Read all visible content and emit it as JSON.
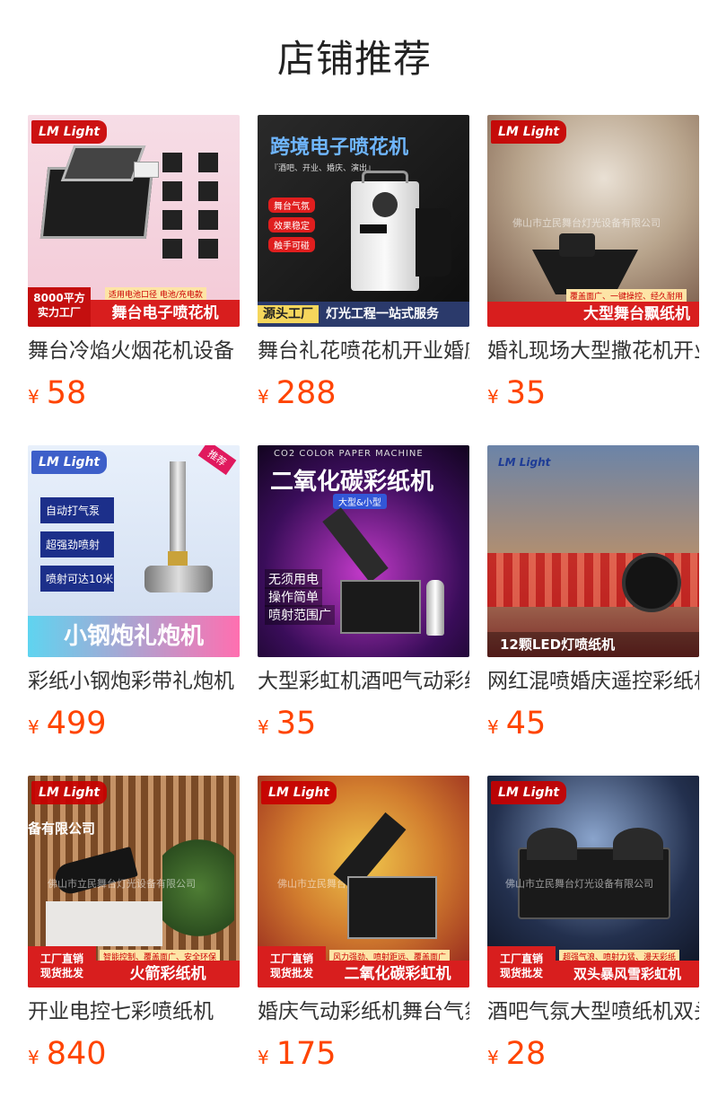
{
  "page": {
    "title": "店铺推荐"
  },
  "products": [
    {
      "name": "舞台冷焰火烟花机设备",
      "currency": "¥",
      "price": "58",
      "image": {
        "logo": "LM Light",
        "corner_text": "8000平方\n实力工厂",
        "top_strip": "适用电池口径  电池/充电款",
        "banner": "舞台电子喷花机"
      }
    },
    {
      "name": "舞台礼花喷花机开业婚庆",
      "currency": "¥",
      "price": "288",
      "image": {
        "headline": "跨境电子喷花机",
        "subline": "『酒吧、开业、婚庆、演出』",
        "tags": [
          "舞台气氛",
          "效果稳定",
          "触手可碰"
        ],
        "banner_left": "源头工厂",
        "banner_right": "灯光工程一站式服务"
      }
    },
    {
      "name": "婚礼现场大型撒花机开业",
      "currency": "¥",
      "price": "35",
      "image": {
        "logo": "LM Light",
        "watermark": "佛山市立民舞台灯光设备有限公司",
        "top_strip": "覆盖面广、一键操控、经久耐用",
        "banner": "大型舞台飘纸机"
      }
    },
    {
      "name": "彩纸小钢炮彩带礼炮机",
      "currency": "¥",
      "price": "499",
      "image": {
        "logo": "LM Light",
        "corner_tag": "推荐",
        "features": [
          "自动打气泵",
          "超强劲喷射",
          "喷射可达10米"
        ],
        "banner": "小钢炮礼炮机"
      }
    },
    {
      "name": "大型彩虹机酒吧气动彩纸",
      "currency": "¥",
      "price": "35",
      "image": {
        "top_caption": "CO2 COLOR PAPER MACHINE",
        "headline": "二氧化碳彩纸机",
        "subtag": "大型&小型",
        "features": [
          "无须用电",
          "操作简单",
          "喷射范围广"
        ]
      }
    },
    {
      "name": "网红混喷婚庆遥控彩纸机",
      "currency": "¥",
      "price": "45",
      "image": {
        "logo": "LM Light",
        "banner": "12颗LED灯喷纸机"
      }
    },
    {
      "name": "开业电控七彩喷纸机",
      "currency": "¥",
      "price": "840",
      "image": {
        "logo": "LM Light",
        "wall_text": "备有限公司",
        "watermark": "佛山市立民舞台灯光设备有限公司",
        "corner_text": "工厂直销\n现货批发",
        "top_strip": "智能控制、覆盖面广、安全环保",
        "banner": "火箭彩纸机"
      }
    },
    {
      "name": "婚庆气动彩纸机舞台气氛",
      "currency": "¥",
      "price": "175",
      "image": {
        "logo": "LM Light",
        "watermark": "佛山市立民舞台灯光设备有限公司",
        "corner_text": "工厂直销\n现货批发",
        "top_strip": "风力强劲、喷射距远、覆盖面广",
        "banner": "二氧化碳彩虹机"
      }
    },
    {
      "name": "酒吧气氛大型喷纸机双头",
      "currency": "¥",
      "price": "28",
      "image": {
        "logo": "LM Light",
        "watermark": "佛山市立民舞台灯光设备有限公司",
        "corner_text": "工厂直销\n现货批发",
        "top_strip": "超强气浪、喷射力猛、漫天彩纸",
        "banner": "双头暴风雪彩虹机"
      }
    }
  ],
  "colors": {
    "price": "#ff4400",
    "brand_red": "#d81e1e",
    "title": "#222222"
  }
}
